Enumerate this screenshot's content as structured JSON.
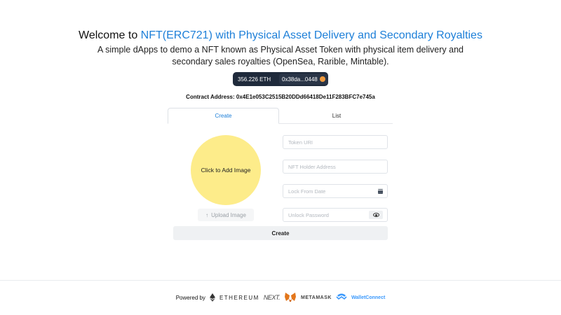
{
  "header": {
    "title_prefix": "Welcome to ",
    "title_link": "NFT(ERC721) with Physical Asset Delivery and Secondary Royalties",
    "subtitle_line1": "A simple dApps to demo a NFT known as Physical Asset Token with physical item delivery and",
    "subtitle_line2": "secondary sales royalties (OpenSea, Rarible, Mintable)."
  },
  "wallet": {
    "balance": "356.226 ETH",
    "address": "0x38da...0448",
    "icon": "metamask-fox-icon"
  },
  "contract": {
    "label": "Contract Address: 0x4E1e053C2515B20DDd66418De11F283BFC7e745a"
  },
  "tabs": [
    {
      "label": "Create",
      "active": true
    },
    {
      "label": "List",
      "active": false
    }
  ],
  "form": {
    "image_placeholder": "Click to Add Image",
    "upload_label": "Upload Image",
    "token_uri_placeholder": "Token URI",
    "holder_placeholder": "NFT Holder Address",
    "lock_date_placeholder": "Lock From Date",
    "password_placeholder": "Unlock Password",
    "submit_label": "Create"
  },
  "footer": {
    "powered_by": "Powered by",
    "ethereum": "ETHEREUM",
    "next": "NEXT.",
    "metamask": "METAMASK",
    "walletconnect": "WalletConnect"
  },
  "colors": {
    "link": "#1d7fd8",
    "image_circle": "#fdec8a",
    "wallet_pill": "#1f2a3b"
  }
}
